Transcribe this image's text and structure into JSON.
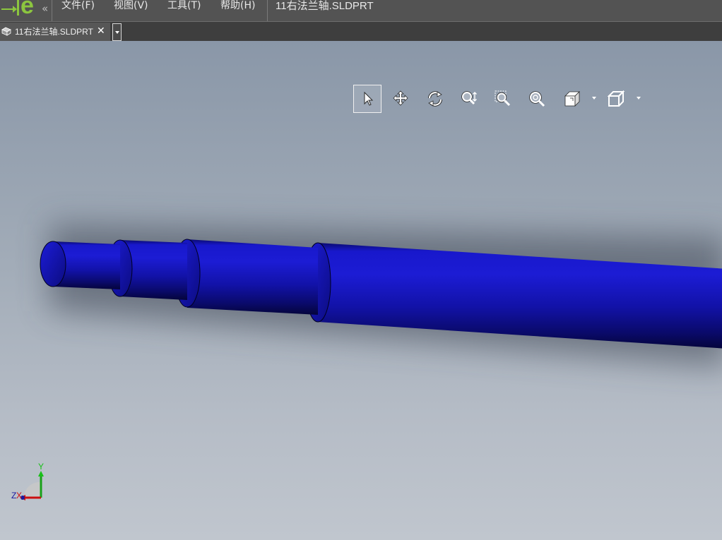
{
  "app": {
    "logo_letter": "e",
    "collapse_glyph": "«"
  },
  "menu": {
    "items": [
      {
        "label": "文件(F)"
      },
      {
        "label": "视图(V)"
      },
      {
        "label": "工具(T)"
      },
      {
        "label": "帮助(H)"
      }
    ],
    "document_title": "11右法兰轴.SLDPRT"
  },
  "tabs": [
    {
      "label": "11右法兰轴.SLDPRT",
      "close_glyph": "✕",
      "icon": "part-icon",
      "active": true
    }
  ],
  "toolbar": {
    "buttons": [
      {
        "name": "select-icon",
        "active": true
      },
      {
        "name": "pan-icon",
        "active": false
      },
      {
        "name": "rotate-icon",
        "active": false
      },
      {
        "name": "zoom-in-out-icon",
        "active": false
      },
      {
        "name": "zoom-to-area-icon",
        "active": false
      },
      {
        "name": "zoom-to-fit-icon",
        "active": false
      },
      {
        "name": "display-style-icon",
        "active": false,
        "has_dropdown": true
      },
      {
        "name": "view-orientation-icon",
        "active": false,
        "has_dropdown": true
      }
    ]
  },
  "triad": {
    "y_label": "Y",
    "z_label": "Z",
    "x_label": "X"
  },
  "colors": {
    "menubar_bg": "#535353",
    "logo_green": "#8cc63f",
    "model_blue": "#1010c8",
    "viewport_top": "#8a97a8",
    "viewport_bottom": "#c0c6ce"
  }
}
